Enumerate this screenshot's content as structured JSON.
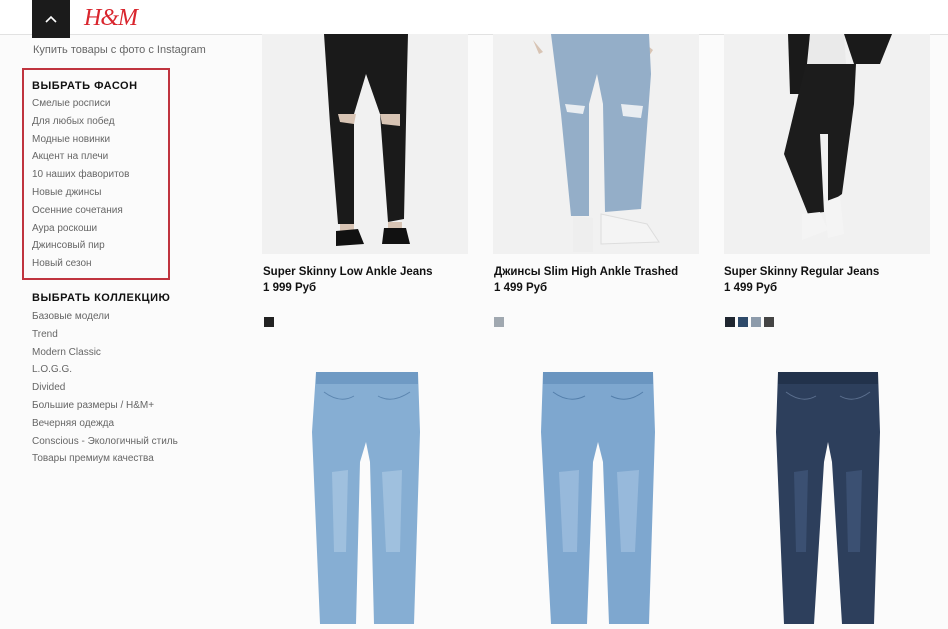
{
  "header": {
    "logo": "H&M"
  },
  "sidebar": {
    "instagram_link": "Купить товары с фото с Instagram",
    "style_heading": "ВЫБРАТЬ ФАСОН",
    "style_items": [
      "Смелые росписи",
      "Для любых побед",
      "Модные новинки",
      "Акцент на плечи",
      "10 наших фаворитов",
      "Новые джинсы",
      "Осенние сочетания",
      "Аура роскоши",
      "Джинсовый пир",
      "Новый сезон"
    ],
    "collection_heading": "ВЫБРАТЬ КОЛЛЕКЦИЮ",
    "collection_items": [
      "Базовые модели",
      "Trend",
      "Modern Classic",
      "L.O.G.G.",
      "Divided",
      "Большие размеры / H&M+",
      "Вечерняя одежда",
      "Conscious - Экологичный стиль",
      "Товары премиум качества"
    ]
  },
  "products": [
    {
      "name": "Super Skinny Low Ankle Jeans",
      "price": "1 999 Руб",
      "swatches": [
        "#222222"
      ]
    },
    {
      "name": "Джинсы Slim High Ankle Trashed",
      "price": "1 499 Руб",
      "swatches": [
        "#a0a8b0"
      ]
    },
    {
      "name": "Super Skinny Regular Jeans",
      "price": "1 499 Руб",
      "swatches": [
        "#1f2630",
        "#2e4a6a",
        "#8d9bab",
        "#444444"
      ]
    }
  ],
  "colors": {
    "accent_box": "#c0343f",
    "header_button": "#1b1b1b"
  }
}
